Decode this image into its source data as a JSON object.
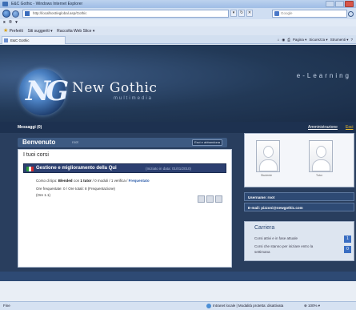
{
  "browser": {
    "title": "E&C Gothic - Windows Internet Explorer",
    "url": "http://localhost/eglobal.asp/Gothic",
    "search_placeholder": "Google",
    "menu_items": [
      "x",
      "®",
      "▾"
    ],
    "favorites_label": "Preferiti",
    "favorites_items": [
      "Siti suggeriti ▾",
      "Raccolta Web Slice ▾"
    ],
    "tab_label": "E&C Gothic",
    "cmd_items": [
      "Pagina ▾",
      "Sicurezza ▾",
      "Strumenti ▾",
      "?"
    ],
    "status_left": "Fine",
    "status_zone": "Intranet locale | Modalità protetta: disattivata",
    "status_zoom": "⊕ 100% ▾"
  },
  "header": {
    "brand": "New Gothic",
    "brand_sub": "multimedia",
    "tagline": "e-Learning",
    "logo_mark": "NG"
  },
  "topnav": {
    "messages": "Messaggi (0)",
    "admin": "Amministrazione",
    "exit": "Esci"
  },
  "welcome": {
    "title": "Benvenuto",
    "user": "root",
    "button": "Esci e abbandona"
  },
  "courses": {
    "heading": "I tuoi corsi",
    "course": {
      "name": "Gestione e miglioramento della Qui",
      "date": "(Iniziato in data: 01/01/2010)",
      "line1_prefix": "Corso di tipo:",
      "line1_type": "Blended",
      "line1_mid": "con",
      "line1_tutor": "1 tutor",
      "line1_rest": "/ 0 moduli / 1 verifica /",
      "line1_link": "Frequentato",
      "line2": "Ore frequentate: 0 / Ore totali: 8 (Frequentazione)",
      "line3": "(Ore 1.1)"
    }
  },
  "right": {
    "avatar_labels": [
      "Studente",
      "Tutor"
    ],
    "username_label": "Username: root",
    "email_label": "E-mail: pizzoni@newgothic.com",
    "careers": {
      "title": "Carriera",
      "lines": [
        "Corsi attivi e in fase attuale",
        "Corsi che stanno per iniziare entro la",
        "settimana"
      ],
      "badges": [
        "1",
        "0"
      ]
    }
  }
}
